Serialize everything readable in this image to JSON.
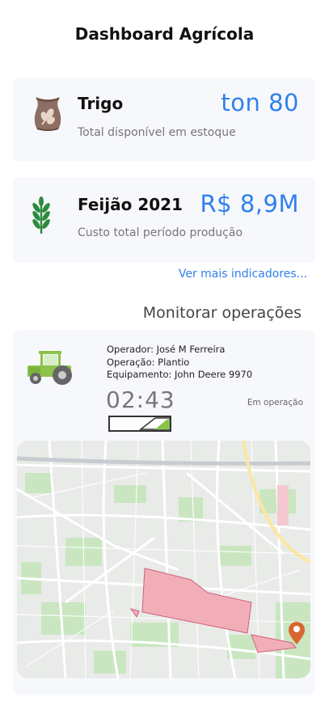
{
  "header": {
    "title": "Dashboard Agrícola"
  },
  "indicators": [
    {
      "name": "Trigo",
      "value": "ton 80",
      "subtitle": "Total disponível em estoque",
      "icon": "grain-sack-icon"
    },
    {
      "name": "Feijão 2021",
      "value": "R$ 8,9M",
      "subtitle": "Custo total período produção",
      "icon": "wheat-plant-icon"
    }
  ],
  "more_link": "Ver mais indicadores...",
  "monitor": {
    "section_title": "Monitorar operações",
    "operator": "Operador: José M Ferreira",
    "operation": "Operação: Plantio",
    "equipment": "Equipamento: John Deere 9970",
    "timer": "02:43",
    "status": "Em operação",
    "fuel_level": 0.5,
    "icons": {
      "vehicle": "tractor-icon",
      "pin": "map-pin-icon"
    }
  },
  "colors": {
    "accent": "#2f80ed",
    "tractor": "#8bc34a",
    "field": "#f2aeb8",
    "pin": "#d9662e",
    "plant": "#2e8b3d",
    "sack": "#8d6e63"
  }
}
